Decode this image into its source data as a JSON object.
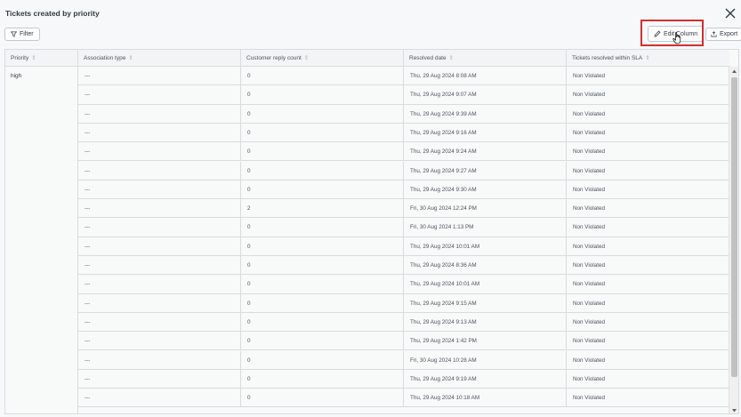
{
  "header": {
    "title": "Tickets created by priority"
  },
  "toolbar": {
    "filter_label": "Filter",
    "edit_label": "Edit Column",
    "export_label": "Export"
  },
  "table": {
    "columns": [
      "Priority",
      "Association type",
      "Customer reply count",
      "Resolved date",
      "Tickets resolved within SLA"
    ],
    "priority_value": "high",
    "rows": [
      {
        "assoc": "---",
        "replies": "0",
        "resolved": "Thu, 29 Aug 2024 8:08 AM",
        "sla": "Non Violated"
      },
      {
        "assoc": "---",
        "replies": "0",
        "resolved": "Thu, 29 Aug 2024 9:07 AM",
        "sla": "Non Violated"
      },
      {
        "assoc": "---",
        "replies": "0",
        "resolved": "Thu, 29 Aug 2024 9:39 AM",
        "sla": "Non Violated"
      },
      {
        "assoc": "---",
        "replies": "0",
        "resolved": "Thu, 29 Aug 2024 9:16 AM",
        "sla": "Non Violated"
      },
      {
        "assoc": "---",
        "replies": "0",
        "resolved": "Thu, 29 Aug 2024 9:24 AM",
        "sla": "Non Violated"
      },
      {
        "assoc": "---",
        "replies": "0",
        "resolved": "Thu, 29 Aug 2024 9:27 AM",
        "sla": "Non Violated"
      },
      {
        "assoc": "---",
        "replies": "0",
        "resolved": "Thu, 29 Aug 2024 9:30 AM",
        "sla": "Non Violated"
      },
      {
        "assoc": "---",
        "replies": "2",
        "resolved": "Fri, 30 Aug 2024 12:24 PM",
        "sla": "Non Violated"
      },
      {
        "assoc": "---",
        "replies": "0",
        "resolved": "Fri, 30 Aug 2024 1:13 PM",
        "sla": "Non Violated"
      },
      {
        "assoc": "---",
        "replies": "0",
        "resolved": "Thu, 29 Aug 2024 10:01 AM",
        "sla": "Non Violated"
      },
      {
        "assoc": "---",
        "replies": "0",
        "resolved": "Thu, 29 Aug 2024 8:36 AM",
        "sla": "Non Violated"
      },
      {
        "assoc": "---",
        "replies": "0",
        "resolved": "Thu, 29 Aug 2024 10:01 AM",
        "sla": "Non Violated"
      },
      {
        "assoc": "---",
        "replies": "0",
        "resolved": "Thu, 29 Aug 2024 9:15 AM",
        "sla": "Non Violated"
      },
      {
        "assoc": "---",
        "replies": "0",
        "resolved": "Thu, 29 Aug 2024 9:13 AM",
        "sla": "Non Violated"
      },
      {
        "assoc": "---",
        "replies": "0",
        "resolved": "Thu, 29 Aug 2024 1:42 PM",
        "sla": "Non Violated"
      },
      {
        "assoc": "---",
        "replies": "0",
        "resolved": "Fri, 30 Aug 2024 10:28 AM",
        "sla": "Non Violated"
      },
      {
        "assoc": "---",
        "replies": "0",
        "resolved": "Thu, 29 Aug 2024 9:19 AM",
        "sla": "Non Violated"
      },
      {
        "assoc": "---",
        "replies": "0",
        "resolved": "Thu, 29 Aug 2024 10:18 AM",
        "sla": "Non Violated"
      }
    ]
  },
  "colors": {
    "highlight": "#d32f2f",
    "border": "#d8dcde"
  }
}
